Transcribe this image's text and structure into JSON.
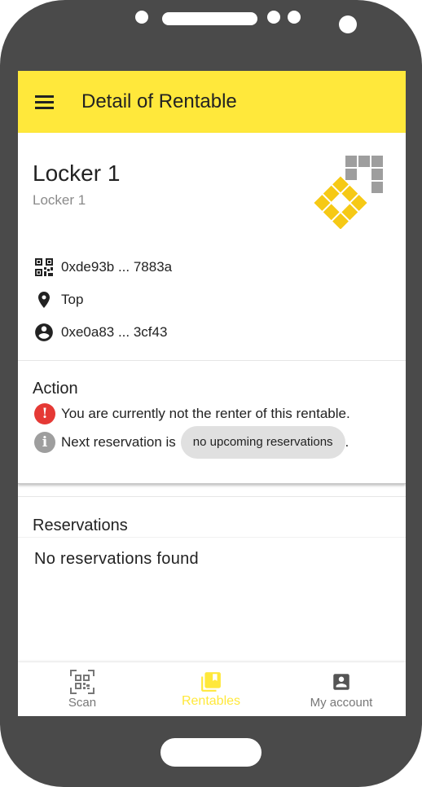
{
  "appbar": {
    "title": "Detail of Rentable",
    "menu_icon": "menu-icon"
  },
  "rentable": {
    "name": "Locker 1",
    "description": "Locker 1",
    "address": "0xde93b ... 7883a",
    "location": "Top",
    "owner": "0xe0a83 ... 3cf43"
  },
  "action": {
    "title": "Action",
    "not_renter_text": "You are currently not the renter of this rentable.",
    "next_reservation_prefix": "Next reservation is",
    "next_reservation_chip": "no upcoming reservations",
    "next_reservation_suffix": "."
  },
  "reservations": {
    "title": "Reservations",
    "empty_text": "No reservations found"
  },
  "bottom_nav": {
    "items": [
      {
        "label": "Scan",
        "icon": "qr-scan-icon"
      },
      {
        "label": "Rentables",
        "icon": "library-books-icon",
        "active": true
      },
      {
        "label": "My account",
        "icon": "account-box-icon"
      }
    ]
  },
  "colors": {
    "accent": "#ffe83b",
    "error": "#e53935",
    "info": "#9e9e9e",
    "logo_gray": "#9e9e9e",
    "logo_yellow": "#f6c915"
  }
}
